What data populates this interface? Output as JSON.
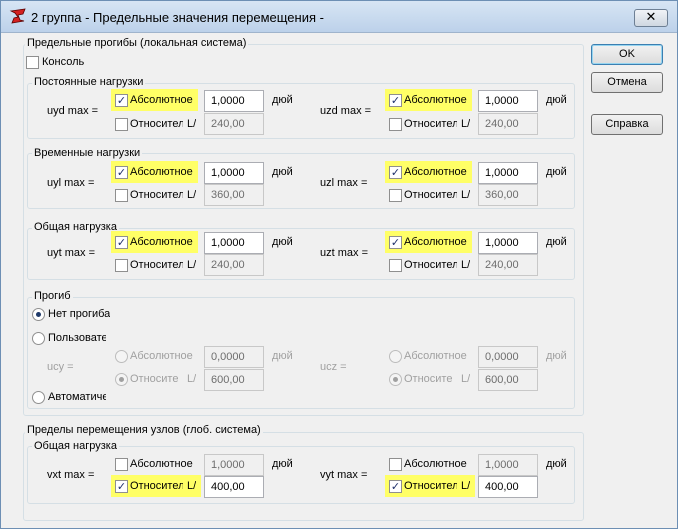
{
  "window": {
    "title": "2 группа - Предельные значения перемещения -",
    "close_glyph": "✕"
  },
  "buttons": {
    "ok": "OK",
    "cancel": "Отмена",
    "help": "Справка"
  },
  "local": {
    "label": "Предельные прогибы (локальная система)",
    "console": {
      "label": "Консоль",
      "checked": false
    },
    "permanent": {
      "label": "Постоянные нагрузки",
      "y": {
        "name": "uyd max =",
        "abs_label": "Абсолютное",
        "abs_value": "1,0000",
        "unit": "дюй",
        "rel_label": "Относител",
        "rel_prefix": "L/",
        "rel_value": "240,00"
      },
      "z": {
        "name": "uzd max =",
        "abs_label": "Абсолютное",
        "abs_value": "1,0000",
        "unit": "дюй",
        "rel_label": "Относител",
        "rel_prefix": "L/",
        "rel_value": "240,00"
      }
    },
    "temporary": {
      "label": "Временные нагрузки",
      "y": {
        "name": "uyl max =",
        "abs_label": "Абсолютное",
        "abs_value": "1,0000",
        "unit": "дюй",
        "rel_label": "Относител",
        "rel_prefix": "L/",
        "rel_value": "360,00"
      },
      "z": {
        "name": "uzl max =",
        "abs_label": "Абсолютное",
        "abs_value": "1,0000",
        "unit": "дюй",
        "rel_label": "Относител",
        "rel_prefix": "L/",
        "rel_value": "360,00"
      }
    },
    "total": {
      "label": "Общая нагрузка",
      "y": {
        "name": "uyt max =",
        "abs_label": "Абсолютное",
        "abs_value": "1,0000",
        "unit": "дюй",
        "rel_label": "Относител",
        "rel_prefix": "L/",
        "rel_value": "240,00"
      },
      "z": {
        "name": "uzt max =",
        "abs_label": "Абсолютное",
        "abs_value": "1,0000",
        "unit": "дюй",
        "rel_label": "Относител",
        "rel_prefix": "L/",
        "rel_value": "240,00"
      }
    },
    "camber": {
      "label": "Прогиб",
      "none": "Нет прогиба",
      "user": "Пользователь",
      "auto": "Автоматиче",
      "y": {
        "name": "ucy =",
        "abs_label": "Абсолютное",
        "abs_value": "0,0000",
        "unit": "дюй",
        "rel_label": "Относите",
        "rel_prefix": "L/",
        "rel_value": "600,00"
      },
      "z": {
        "name": "ucz =",
        "abs_label": "Абсолютное",
        "abs_value": "0,0000",
        "unit": "дюй",
        "rel_label": "Относите",
        "rel_prefix": "L/",
        "rel_value": "600,00"
      }
    }
  },
  "global": {
    "label": "Пределы перемещения узлов (глоб. система)",
    "total": {
      "label": "Общая нагрузка",
      "x": {
        "name": "vxt max =",
        "abs_label": "Абсолютное",
        "abs_value": "1,0000",
        "unit": "дюй",
        "rel_label": "Относител",
        "rel_prefix": "L/",
        "rel_value": "400,00"
      },
      "y": {
        "name": "vyt max =",
        "abs_label": "Абсолютное",
        "abs_value": "1,0000",
        "unit": "дюй",
        "rel_label": "Относител",
        "rel_prefix": "L/",
        "rel_value": "400,00"
      }
    }
  },
  "colors": {
    "highlight": "#ffff66",
    "title_bar": "#c9dbef"
  }
}
